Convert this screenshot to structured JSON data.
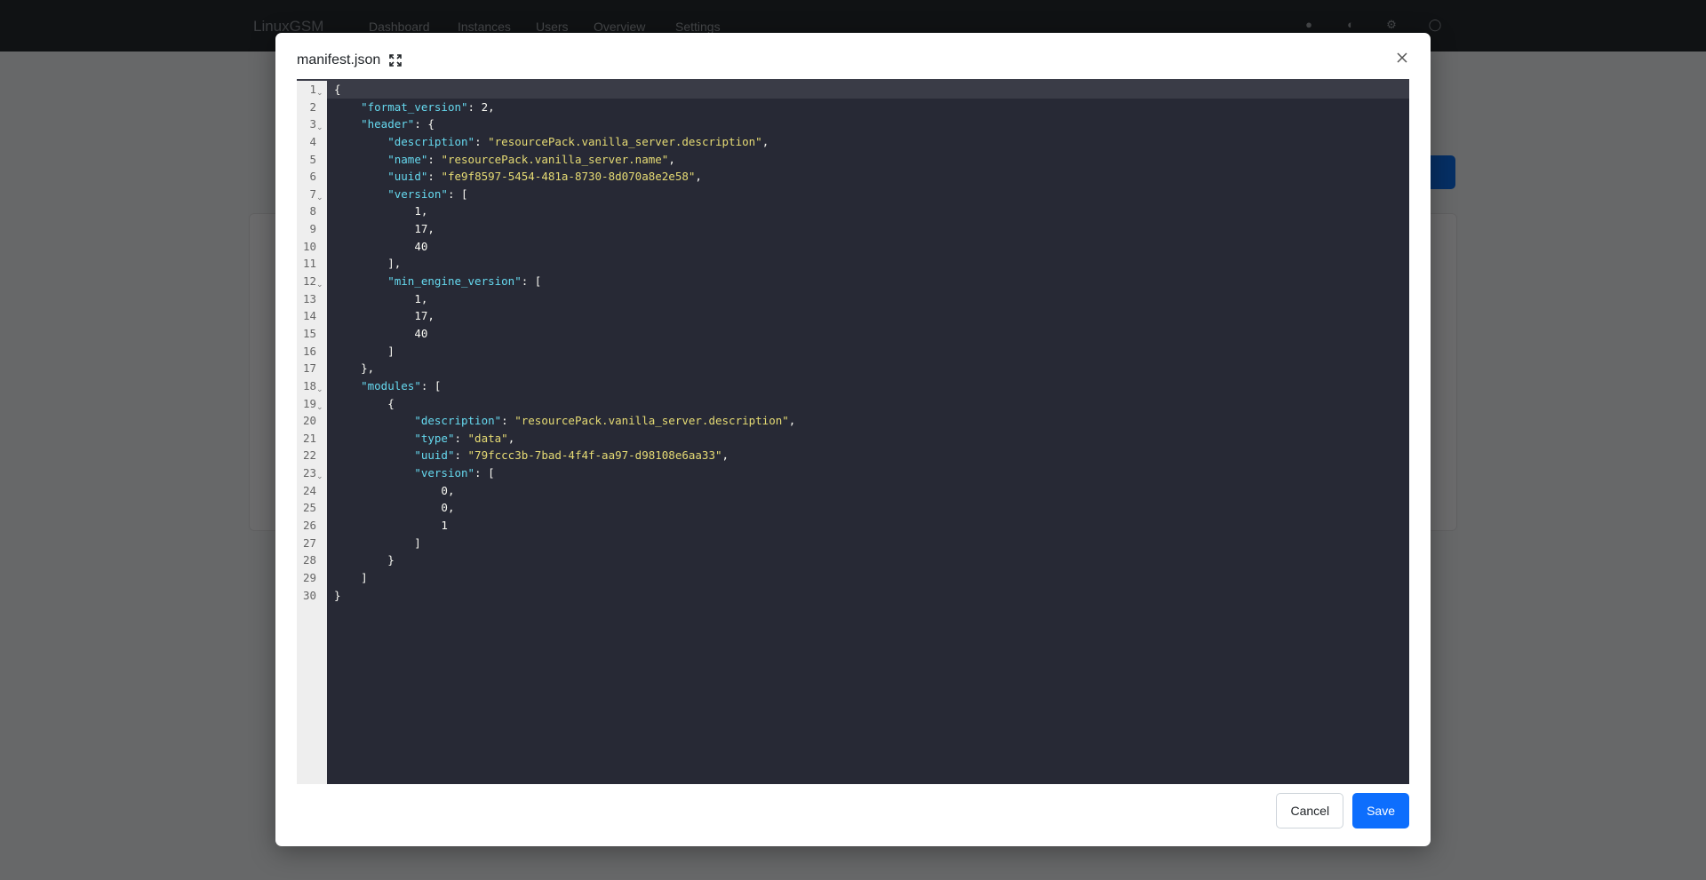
{
  "background": {
    "brand": "LinuxGSM",
    "nav": [
      "Dashboard",
      "Instances",
      "Users",
      "Overview",
      "Settings"
    ]
  },
  "modal": {
    "title": "manifest.json",
    "cancel_label": "Cancel",
    "save_label": "Save",
    "code_lines": [
      {
        "n": "1",
        "fold": true,
        "active": true,
        "tokens": [
          [
            "p",
            "{"
          ]
        ]
      },
      {
        "n": "2",
        "tokens": [
          [
            "p",
            "    "
          ],
          [
            "k",
            "\"format_version\""
          ],
          [
            "p",
            ": "
          ],
          [
            "n",
            "2"
          ],
          [
            "p",
            ","
          ]
        ]
      },
      {
        "n": "3",
        "fold": true,
        "tokens": [
          [
            "p",
            "    "
          ],
          [
            "k",
            "\"header\""
          ],
          [
            "p",
            ": {"
          ]
        ]
      },
      {
        "n": "4",
        "tokens": [
          [
            "p",
            "        "
          ],
          [
            "k",
            "\"description\""
          ],
          [
            "p",
            ": "
          ],
          [
            "s",
            "\"resourcePack.vanilla_server.description\""
          ],
          [
            "p",
            ","
          ]
        ]
      },
      {
        "n": "5",
        "tokens": [
          [
            "p",
            "        "
          ],
          [
            "k",
            "\"name\""
          ],
          [
            "p",
            ": "
          ],
          [
            "s",
            "\"resourcePack.vanilla_server.name\""
          ],
          [
            "p",
            ","
          ]
        ]
      },
      {
        "n": "6",
        "tokens": [
          [
            "p",
            "        "
          ],
          [
            "k",
            "\"uuid\""
          ],
          [
            "p",
            ": "
          ],
          [
            "s",
            "\"fe9f8597-5454-481a-8730-8d070a8e2e58\""
          ],
          [
            "p",
            ","
          ]
        ]
      },
      {
        "n": "7",
        "fold": true,
        "tokens": [
          [
            "p",
            "        "
          ],
          [
            "k",
            "\"version\""
          ],
          [
            "p",
            ": ["
          ]
        ]
      },
      {
        "n": "8",
        "tokens": [
          [
            "p",
            "            "
          ],
          [
            "n",
            "1"
          ],
          [
            "p",
            ","
          ]
        ]
      },
      {
        "n": "9",
        "tokens": [
          [
            "p",
            "            "
          ],
          [
            "n",
            "17"
          ],
          [
            "p",
            ","
          ]
        ]
      },
      {
        "n": "10",
        "tokens": [
          [
            "p",
            "            "
          ],
          [
            "n",
            "40"
          ]
        ]
      },
      {
        "n": "11",
        "tokens": [
          [
            "p",
            "        ],"
          ]
        ]
      },
      {
        "n": "12",
        "fold": true,
        "tokens": [
          [
            "p",
            "        "
          ],
          [
            "k",
            "\"min_engine_version\""
          ],
          [
            "p",
            ": ["
          ]
        ]
      },
      {
        "n": "13",
        "tokens": [
          [
            "p",
            "            "
          ],
          [
            "n",
            "1"
          ],
          [
            "p",
            ","
          ]
        ]
      },
      {
        "n": "14",
        "tokens": [
          [
            "p",
            "            "
          ],
          [
            "n",
            "17"
          ],
          [
            "p",
            ","
          ]
        ]
      },
      {
        "n": "15",
        "tokens": [
          [
            "p",
            "            "
          ],
          [
            "n",
            "40"
          ]
        ]
      },
      {
        "n": "16",
        "tokens": [
          [
            "p",
            "        ]"
          ]
        ]
      },
      {
        "n": "17",
        "tokens": [
          [
            "p",
            "    },"
          ]
        ]
      },
      {
        "n": "18",
        "fold": true,
        "tokens": [
          [
            "p",
            "    "
          ],
          [
            "k",
            "\"modules\""
          ],
          [
            "p",
            ": ["
          ]
        ]
      },
      {
        "n": "19",
        "fold": true,
        "tokens": [
          [
            "p",
            "        {"
          ]
        ]
      },
      {
        "n": "20",
        "tokens": [
          [
            "p",
            "            "
          ],
          [
            "k",
            "\"description\""
          ],
          [
            "p",
            ": "
          ],
          [
            "s",
            "\"resourcePack.vanilla_server.description\""
          ],
          [
            "p",
            ","
          ]
        ]
      },
      {
        "n": "21",
        "tokens": [
          [
            "p",
            "            "
          ],
          [
            "k",
            "\"type\""
          ],
          [
            "p",
            ": "
          ],
          [
            "s",
            "\"data\""
          ],
          [
            "p",
            ","
          ]
        ]
      },
      {
        "n": "22",
        "tokens": [
          [
            "p",
            "            "
          ],
          [
            "k",
            "\"uuid\""
          ],
          [
            "p",
            ": "
          ],
          [
            "s",
            "\"79fccc3b-7bad-4f4f-aa97-d98108e6aa33\""
          ],
          [
            "p",
            ","
          ]
        ]
      },
      {
        "n": "23",
        "fold": true,
        "tokens": [
          [
            "p",
            "            "
          ],
          [
            "k",
            "\"version\""
          ],
          [
            "p",
            ": ["
          ]
        ]
      },
      {
        "n": "24",
        "tokens": [
          [
            "p",
            "                "
          ],
          [
            "n",
            "0"
          ],
          [
            "p",
            ","
          ]
        ]
      },
      {
        "n": "25",
        "tokens": [
          [
            "p",
            "                "
          ],
          [
            "n",
            "0"
          ],
          [
            "p",
            ","
          ]
        ]
      },
      {
        "n": "26",
        "tokens": [
          [
            "p",
            "                "
          ],
          [
            "n",
            "1"
          ]
        ]
      },
      {
        "n": "27",
        "tokens": [
          [
            "p",
            "            ]"
          ]
        ]
      },
      {
        "n": "28",
        "tokens": [
          [
            "p",
            "        }"
          ]
        ]
      },
      {
        "n": "29",
        "tokens": [
          [
            "p",
            "    ]"
          ]
        ]
      },
      {
        "n": "30",
        "tokens": [
          [
            "p",
            "}"
          ]
        ]
      }
    ]
  },
  "colors": {
    "editor_bg": "#272935",
    "key": "#66d9ef",
    "string": "#e6db74",
    "primary": "#0d6efd"
  }
}
